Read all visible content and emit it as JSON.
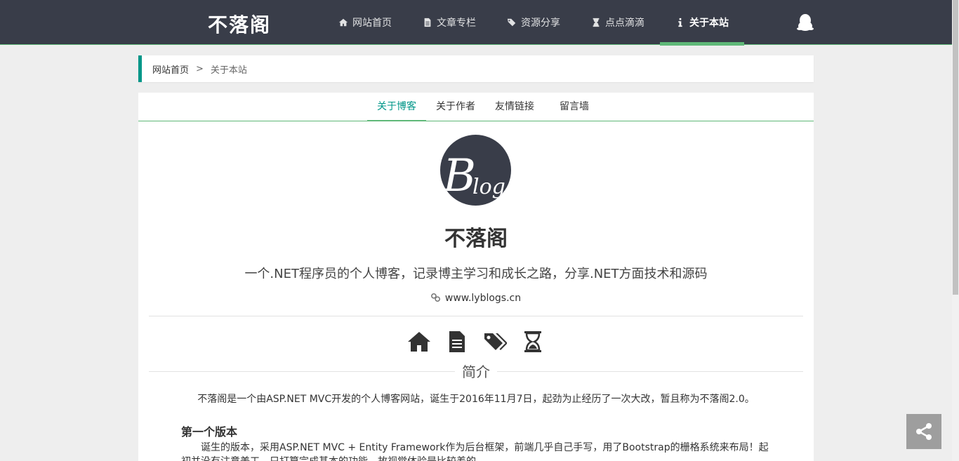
{
  "header": {
    "logo": "不落阁",
    "nav": [
      {
        "label": "网站首页",
        "icon": "home-icon"
      },
      {
        "label": "文章专栏",
        "icon": "file-icon"
      },
      {
        "label": "资源分享",
        "icon": "tags-icon"
      },
      {
        "label": "点点滴滴",
        "icon": "hourglass-icon"
      },
      {
        "label": "关于本站",
        "icon": "info-icon",
        "active": true
      }
    ],
    "qq_icon": "qq-icon"
  },
  "breadcrumb": {
    "home": "网站首页",
    "separator": ">",
    "current": "关于本站"
  },
  "tabs": [
    {
      "label": "关于博客",
      "active": true
    },
    {
      "label": "关于作者"
    },
    {
      "label": "友情链接"
    },
    {
      "label": "留言墙"
    }
  ],
  "about": {
    "avatar_text": "Blog",
    "site_name": "不落阁",
    "motto": "一个.NET程序员的个人博客，记录博主学习和成长之路，分享.NET方面技术和源码",
    "url": "www.lyblogs.cn",
    "icons": [
      "home-icon",
      "file-icon",
      "tags-icon",
      "hourglass-icon"
    ],
    "section_title": "简介",
    "intro": "不落阁是一个由ASP.NET MVC开发的个人博客网站，诞生于2016年11月7日，起劲为止经历了一次大改，暂且称为不落阁2.0。",
    "version_title": "第一个版本",
    "version_text": "诞生的版本，采用ASP.NET MVC + Entity Framework作为后台框架，前端几乎自己手写，用了Bootstrap的栅格系统来布局！起初并没有注意美工，只打算完成基本的功能，故视觉体验是比较差的。"
  },
  "colors": {
    "header_bg": "#393d49",
    "accent_green": "#5fb878",
    "accent_teal": "#009688",
    "share_bg": "#9e9e9e"
  }
}
